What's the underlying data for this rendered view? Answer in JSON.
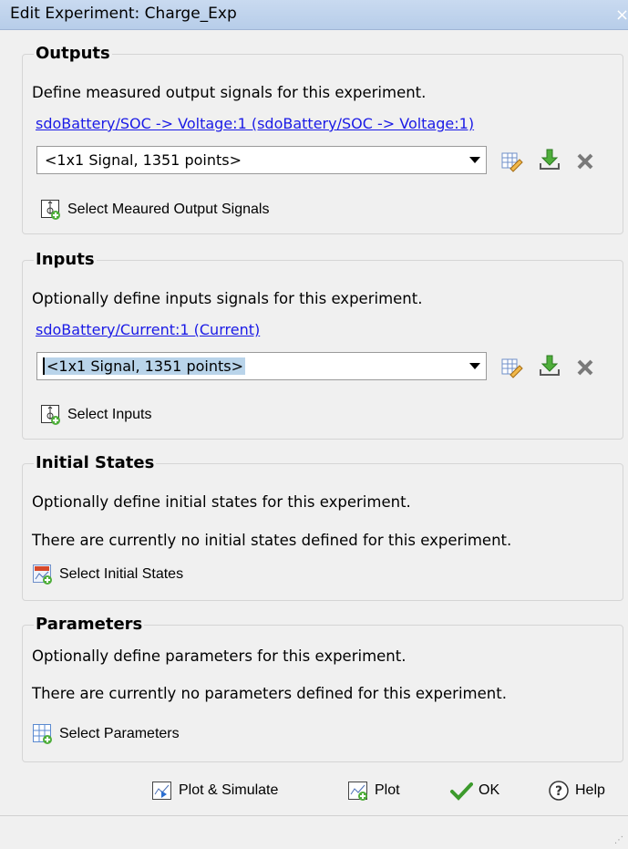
{
  "window": {
    "title": "Edit Experiment: Charge_Exp",
    "close_label": "×"
  },
  "outputs": {
    "title": "Outputs",
    "description": "Define measured output signals for this experiment.",
    "link": "sdoBattery/SOC -> Voltage:1 (sdoBattery/SOC -> Voltage:1)",
    "combo_value": "<1x1 Signal, 1351 points>",
    "select_button": "Select Meaured Output Signals"
  },
  "inputs": {
    "title": "Inputs",
    "description": "Optionally define inputs signals for this experiment.",
    "link": "sdoBattery/Current:1 (Current)",
    "combo_value": "<1x1 Signal, 1351 points>",
    "select_button": "Select Inputs"
  },
  "initial_states": {
    "title": "Initial States",
    "description": "Optionally define initial states for this experiment.",
    "status": "There are currently no initial states defined for this experiment.",
    "select_button": "Select Initial States"
  },
  "parameters": {
    "title": "Parameters",
    "description": "Optionally define parameters for this experiment.",
    "status": "There are currently no parameters defined for this experiment.",
    "select_button": "Select Parameters"
  },
  "footer": {
    "plot_simulate": "Plot & Simulate",
    "plot": "Plot",
    "ok": "OK",
    "help": "Help"
  },
  "colors": {
    "link": "#1a1ae6",
    "ok_check": "#3c9a2c",
    "titlebar": "#c3d6ee"
  }
}
